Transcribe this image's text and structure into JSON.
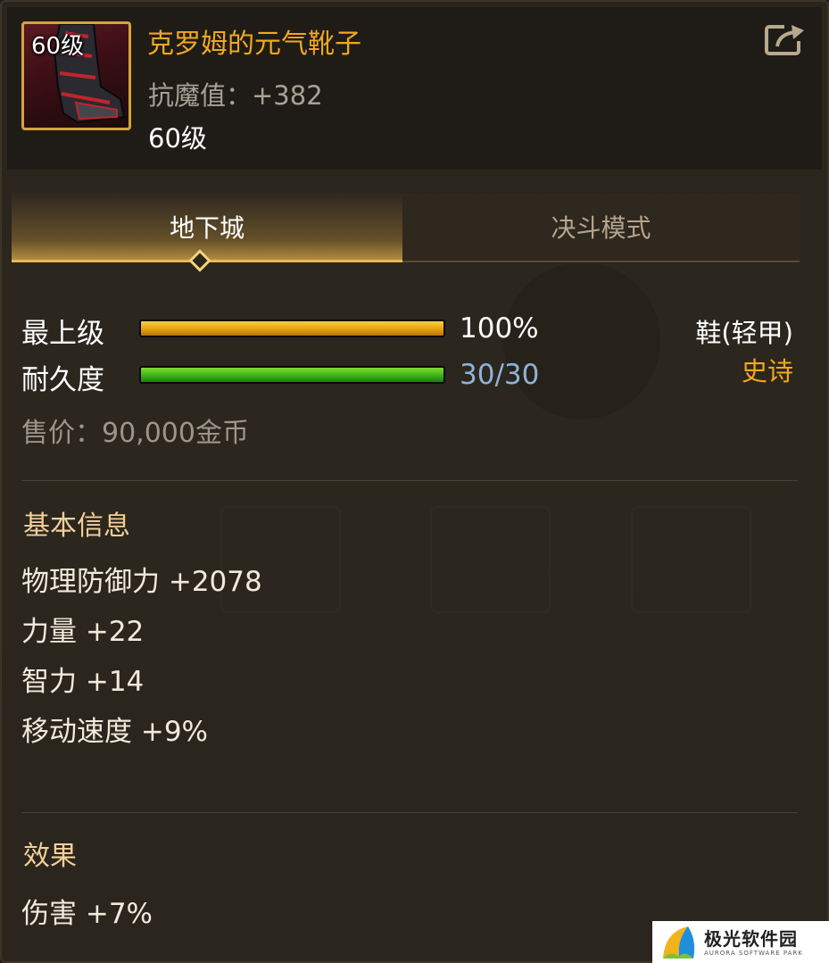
{
  "item": {
    "level_badge": "60级",
    "name": "克罗姆的元气靴子",
    "stat": "抗魔值：+382",
    "required_level": "60级"
  },
  "tabs": [
    {
      "label": "地下城",
      "active": true
    },
    {
      "label": "决斗模式",
      "active": false
    }
  ],
  "bars": {
    "level": {
      "label": "最上级",
      "value_text": "100%",
      "fraction": 1.0
    },
    "durability": {
      "label": "耐久度",
      "value_text": "30/30",
      "fraction": 1.0
    }
  },
  "slot_type": "鞋(轻甲)",
  "rarity": "史诗",
  "price": "售价：90,000金币",
  "basic_info": {
    "title": "基本信息",
    "stats": [
      "物理防御力 +2078",
      "力量 +22",
      "智力 +14",
      "移动速度 +9%"
    ]
  },
  "effects": {
    "title": "效果",
    "stats": [
      "伤害 +7%"
    ]
  },
  "watermark": {
    "name": "极光软件园",
    "sub": "AURORA SOFTWARE PARK"
  },
  "colors": {
    "item_name": "#f0a820",
    "rarity_epic": "#f0a820",
    "level_bar": "#e6a10d",
    "durability_bar": "#3cb01b",
    "durability_text": "#8fb2d8",
    "section_title": "#f2d09a",
    "icon_border": "#d4a33c"
  },
  "icons": {
    "share": "share-icon",
    "item": "boots-icon"
  }
}
